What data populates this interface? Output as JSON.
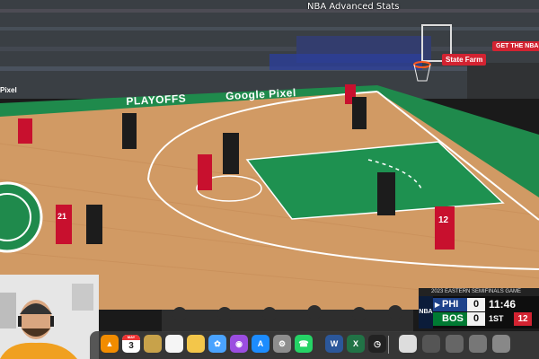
{
  "watermark": "NBA Advanced Stats",
  "ads": {
    "app_button": "GET THE NBA APP",
    "state_farm": "State Farm",
    "board_left": "PLAYOFFS",
    "board_right": "Google Pixel",
    "pixel_left": "Pixel"
  },
  "scoreboard": {
    "header": "2023 EASTERN SEMIFINALS   GAME",
    "logo": "NBA",
    "teams": [
      {
        "abbr": "PHI",
        "score": "0",
        "indicator": "▶"
      },
      {
        "abbr": "BOS",
        "score": "0",
        "indicator": ""
      }
    ],
    "clock": "11:46",
    "quarter": "1ST",
    "shot_clock": "12",
    "colors": {
      "phi": "#1d428a",
      "bos": "#007a33",
      "shot_clock": "#d32331"
    }
  },
  "jerseys": {
    "phi_a": "21",
    "phi_b": "12"
  },
  "dock": {
    "calendar_month": "MAY",
    "calendar_day": "3",
    "word_letter": "W",
    "excel_letter": "X",
    "whatsapp": "☎",
    "appstore": "A"
  },
  "icons": [
    "vlc-icon",
    "calendar-icon",
    "notes-icon",
    "reminders-icon",
    "finder-icon",
    "photos-icon",
    "podcasts-icon",
    "appstore-icon",
    "settings-icon",
    "whatsapp-icon",
    "word-icon",
    "excel-icon",
    "clock-icon",
    "preview-icon"
  ]
}
